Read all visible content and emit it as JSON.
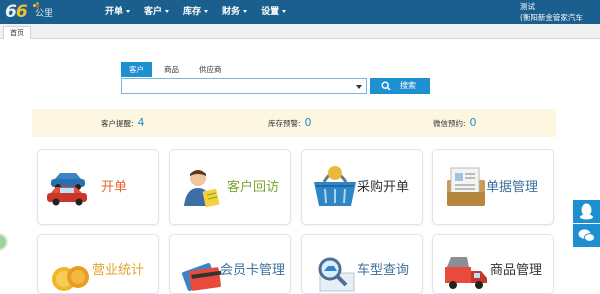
{
  "logo": {
    "number": "66",
    "sub": "公里"
  },
  "nav": [
    {
      "label": "开单"
    },
    {
      "label": "客户"
    },
    {
      "label": "库存"
    },
    {
      "label": "财务"
    },
    {
      "label": "设置"
    }
  ],
  "user": {
    "name": "测试",
    "company": "(衡阳新金管家汽车"
  },
  "tabs": {
    "home": "首页"
  },
  "search": {
    "tabs": [
      "客户",
      "商品",
      "供应商"
    ],
    "active_tab": "客户",
    "button": "搜索",
    "value": ""
  },
  "stats": [
    {
      "label": "客户提醒:",
      "value": "4"
    },
    {
      "label": "库存预警:",
      "value": "0"
    },
    {
      "label": "微信预约:",
      "value": "0"
    }
  ],
  "tiles": [
    {
      "label": "开单",
      "icon": "cars-icon",
      "color": "#e5662e"
    },
    {
      "label": "客户回访",
      "icon": "customer-visit-icon",
      "color": "#7aa531"
    },
    {
      "label": "采购开单",
      "icon": "shopping-basket-icon",
      "color": "#333333"
    },
    {
      "label": "单据管理",
      "icon": "documents-icon",
      "color": "#3e6f9e"
    },
    {
      "label": "营业统计",
      "icon": "coins-icon",
      "color": "#e5a12a"
    },
    {
      "label": "会员卡管理",
      "icon": "member-cards-icon",
      "color": "#3e6f9e"
    },
    {
      "label": "车型查询",
      "icon": "car-search-icon",
      "color": "#3e6f9e"
    },
    {
      "label": "商品管理",
      "icon": "truck-icon",
      "color": "#333333"
    }
  ],
  "floating": [
    "qq-icon",
    "wechat-icon"
  ]
}
